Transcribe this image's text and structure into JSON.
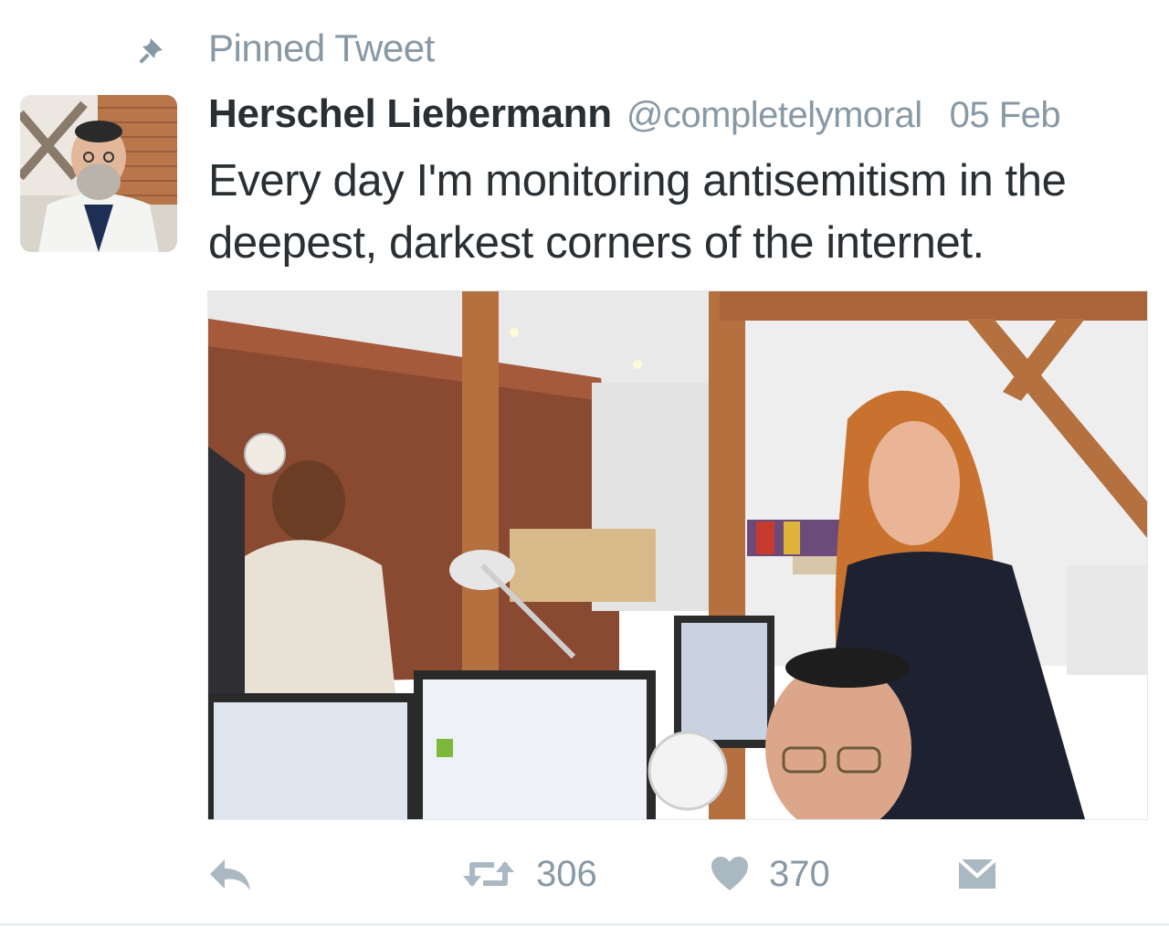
{
  "pinned": {
    "label": "Pinned Tweet",
    "icon": "pin-icon"
  },
  "tweet": {
    "author": {
      "display_name": "Herschel Liebermann",
      "handle": "@completelymoral",
      "avatar": "avatar-photo"
    },
    "date": "05 Feb",
    "text": "Every day I'm monitoring antisemitism in the deepest, darkest corners of the internet.",
    "media": {
      "kind": "photo",
      "description_icon": "office-photo"
    },
    "actions": {
      "reply_icon": "reply-icon",
      "retweet_icon": "retweet-icon",
      "retweet_count": "306",
      "like_icon": "heart-icon",
      "like_count": "370",
      "message_icon": "envelope-icon"
    }
  },
  "colors": {
    "text_primary": "#292f33",
    "text_secondary": "#8899a6",
    "icon_gray": "#aab8c2",
    "divider": "#e1e8ed"
  }
}
